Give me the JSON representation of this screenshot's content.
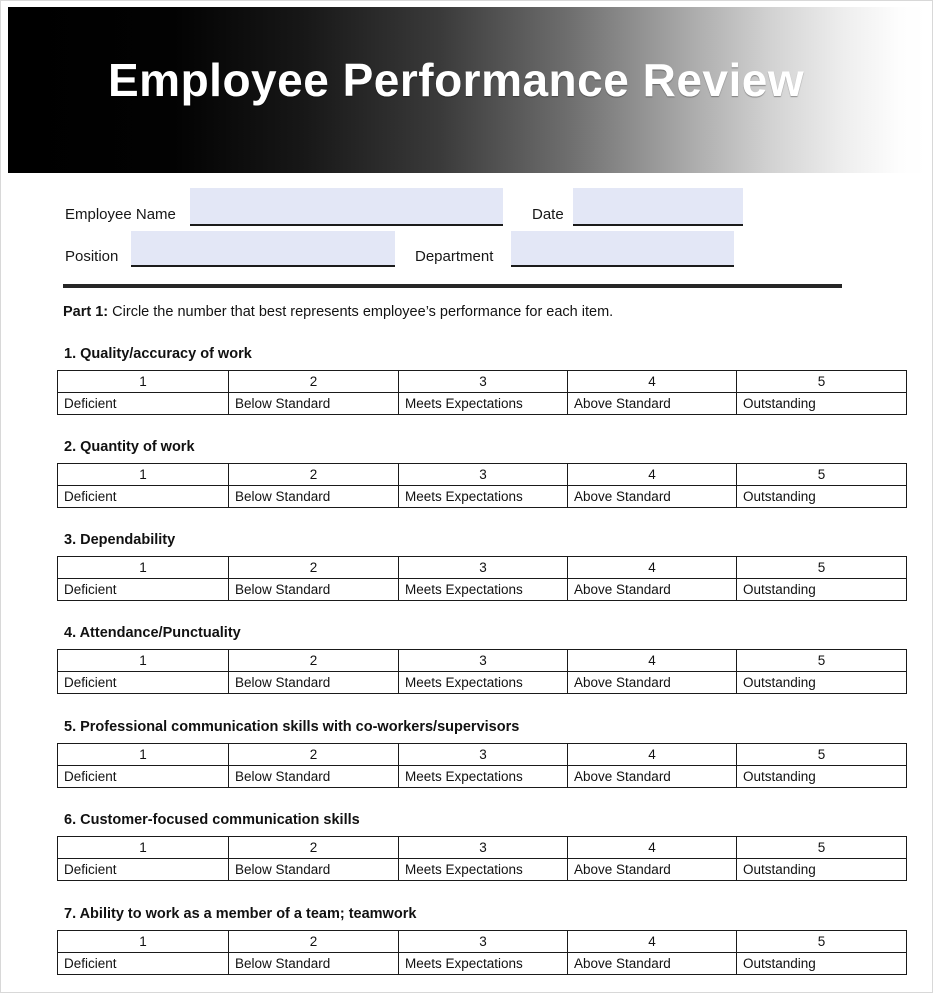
{
  "document": {
    "title": "Employee Performance Review"
  },
  "form": {
    "employee_name": {
      "label": "Employee Name",
      "value": "",
      "placeholder": ""
    },
    "date": {
      "label": "Date",
      "value": "",
      "placeholder": ""
    },
    "position": {
      "label": "Position",
      "value": "",
      "placeholder": ""
    },
    "department": {
      "label": "Department",
      "value": "",
      "placeholder": ""
    }
  },
  "instruction": {
    "lead": "Part 1:",
    "text": " Circle the number that best represents employee’s performance for each item."
  },
  "scale": {
    "scores": [
      "1",
      "2",
      "3",
      "4",
      "5"
    ],
    "labels": [
      "Deficient",
      "Below Standard",
      "Meets Expectations",
      "Above Standard",
      "Outstanding"
    ]
  },
  "items": [
    {
      "number": "1.",
      "title": "1. Quality/accuracy of work"
    },
    {
      "number": "2.",
      "title": "2. Quantity of work"
    },
    {
      "number": "3.",
      "title": "3. Dependability"
    },
    {
      "number": "4.",
      "title": "4. Attendance/Punctuality"
    },
    {
      "number": "5.",
      "title": "5. Professional communication skills with co-workers/supervisors"
    },
    {
      "number": "6.",
      "title": "6. Customer-focused communication skills"
    },
    {
      "number": "7.",
      "title": "7. Ability to work as a member of a team; teamwork"
    }
  ],
  "colors": {
    "field_fill": "#e3e7f6",
    "rule": "#1b1b1b",
    "header_start": "#000000",
    "header_end": "#ffffff",
    "table_border": "#1a1a1a"
  },
  "layout": {
    "item_tops": [
      344,
      437,
      530,
      623,
      717,
      810,
      904
    ]
  }
}
